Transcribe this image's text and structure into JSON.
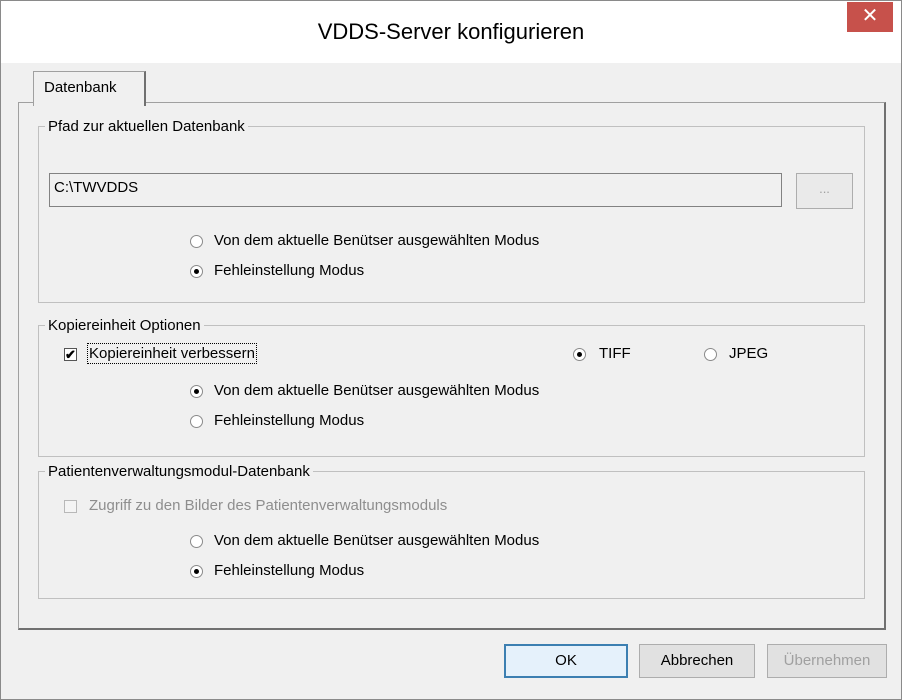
{
  "window": {
    "title": "VDDS-Server konfigurieren",
    "close_label": "✕"
  },
  "tabs": [
    {
      "label": "Datenbank",
      "active": true
    }
  ],
  "db_path_group": {
    "legend": "Pfad zur aktuellen Datenbank",
    "path_value": "C:\\TWVDDS",
    "browse_label": "...",
    "options": [
      {
        "label": "Von dem aktuelle Benütser ausgewählten Modus",
        "selected": false
      },
      {
        "label": "Fehleinstellung Modus",
        "selected": true
      }
    ]
  },
  "copy_group": {
    "legend": "Kopiereinheit Optionen",
    "checkbox_label": "Kopiereinheit verbessern",
    "checkbox_checked": true,
    "check_mark": "✔",
    "format_tiff": {
      "label": "TIFF",
      "selected": true
    },
    "format_jpeg": {
      "label": "JPEG",
      "selected": false
    },
    "options": [
      {
        "label": "Von dem aktuelle Benütser ausgewählten Modus",
        "selected": true
      },
      {
        "label": "Fehleinstellung Modus",
        "selected": false
      }
    ]
  },
  "patient_group": {
    "legend": "Patientenverwaltungsmodul-Datenbank",
    "checkbox_label": "Zugriff zu den Bilder des Patientenverwaltungsmoduls",
    "checkbox_checked": false,
    "checkbox_disabled": true,
    "options": [
      {
        "label": "Von dem aktuelle Benütser ausgewählten Modus",
        "selected": false
      },
      {
        "label": "Fehleinstellung Modus",
        "selected": true
      }
    ]
  },
  "buttons": {
    "ok": "OK",
    "cancel": "Abbrechen",
    "apply": "Übernehmen"
  }
}
